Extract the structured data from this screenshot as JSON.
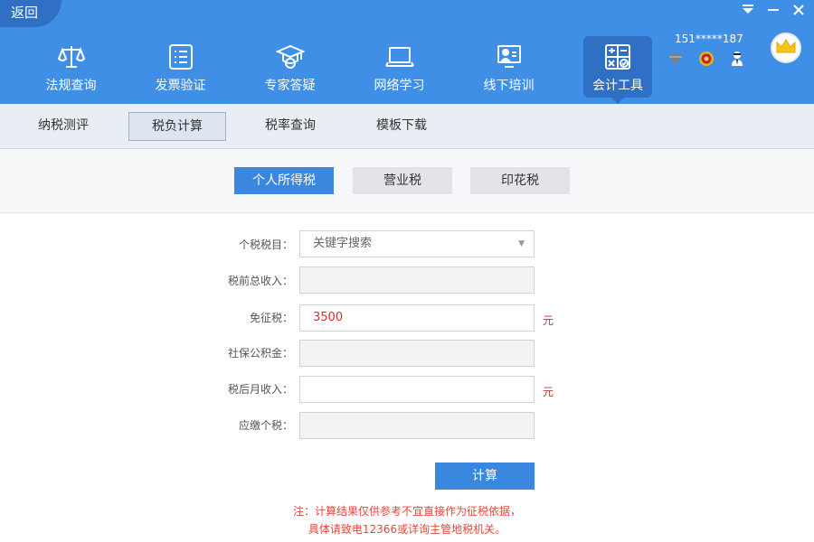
{
  "header": {
    "back_label": "返回",
    "window_controls": [
      "menu-icon",
      "minimize-icon",
      "close-icon"
    ],
    "nav": [
      {
        "label": "法规查询",
        "icon": "scales-icon"
      },
      {
        "label": "发票验证",
        "icon": "list-icon"
      },
      {
        "label": "专家答疑",
        "icon": "graduation-cap-icon"
      },
      {
        "label": "网络学习",
        "icon": "laptop-icon"
      },
      {
        "label": "线下培训",
        "icon": "presentation-icon"
      },
      {
        "label": "会计工具",
        "icon": "calculator-icon",
        "active": true
      }
    ],
    "user": {
      "phone": "151*****187",
      "badges": [
        "diamond-icon",
        "medal-icon",
        "user-agent-icon"
      ],
      "avatar": "crown-icon"
    }
  },
  "subtabs": [
    {
      "label": "纳税测评"
    },
    {
      "label": "税负计算",
      "active": true
    },
    {
      "label": "税率查询"
    },
    {
      "label": "模板下载"
    }
  ],
  "tax_types": [
    {
      "label": "个人所得税",
      "active": true
    },
    {
      "label": "营业税"
    },
    {
      "label": "印花税"
    }
  ],
  "form": {
    "tax_item": {
      "label": "个税税目：",
      "placeholder": "关键字搜索"
    },
    "gross_income": {
      "label": "税前总收入：",
      "value": ""
    },
    "exemption": {
      "label": "免征税：",
      "value": "3500",
      "unit": "元"
    },
    "social_security": {
      "label": "社保公积金：",
      "value": ""
    },
    "net_income": {
      "label": "税后月收入：",
      "value": "",
      "unit": "元"
    },
    "tax_due": {
      "label": "应缴个税：",
      "value": ""
    }
  },
  "calculate_label": "计算",
  "note": {
    "line1": "注：计算结果仅供参考不宜直接作为征税依据，",
    "line2": "具体请致电12366或详询主管地税机关。"
  },
  "colors": {
    "header_bg": "#3f8fe6",
    "active_nav_bg": "#2f6fc4",
    "primary_button": "#3a87e0",
    "warning_text": "#d0312d"
  }
}
